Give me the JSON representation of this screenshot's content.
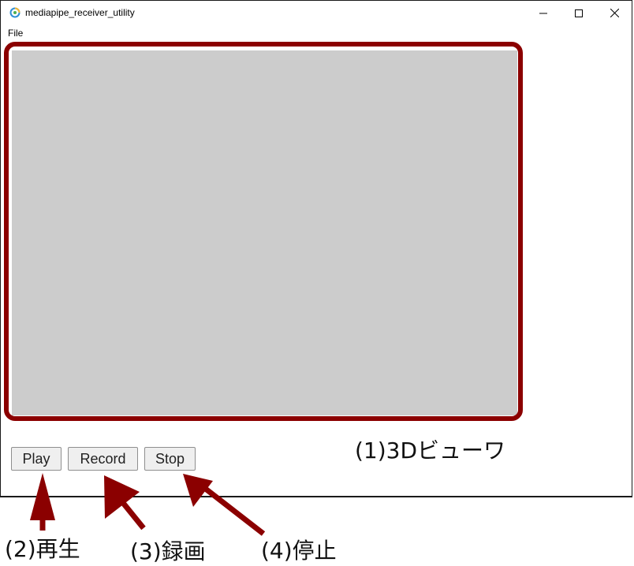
{
  "window": {
    "title": "mediapipe_receiver_utility",
    "controls": {
      "minimize_icon": "minimize-icon",
      "maximize_icon": "maximize-icon",
      "close_icon": "close-icon"
    }
  },
  "menu": {
    "items": [
      {
        "label": "File"
      }
    ]
  },
  "viewport": {
    "background": "#cccccc"
  },
  "controls": {
    "play_label": "Play",
    "record_label": "Record",
    "stop_label": "Stop"
  },
  "annotations": {
    "color": "#8b0000",
    "viewer_label": "(1)3Dビューワ",
    "play_note": "(2)再生",
    "record_note": "(3)録画",
    "stop_note": "(4)停止"
  }
}
